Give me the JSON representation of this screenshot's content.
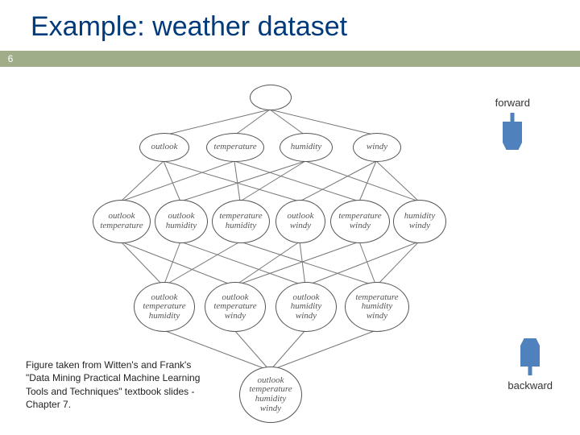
{
  "title": "Example: weather dataset",
  "page_number": "6",
  "labels": {
    "forward": "forward",
    "backward": "backward"
  },
  "caption": "Figure taken from Witten's and Frank's \"Data Mining Practical Machine Learning Tools and Techniques\" textbook slides - Chapter 7.",
  "arrow_color": "#4f81bd",
  "nodes": {
    "root": "",
    "l1a": "outlook",
    "l1b": "temperature",
    "l1c": "humidity",
    "l1d": "windy",
    "l2a": "outlook\ntemperature",
    "l2b": "outlook\nhumidity",
    "l2c": "temperature\nhumidity",
    "l2d": "outlook\nwindy",
    "l2e": "temperature\nwindy",
    "l2f": "humidity\nwindy",
    "l3a": "outlook\ntemperature\nhumidity",
    "l3b": "outlook\ntemperature\nwindy",
    "l3c": "outlook\nhumidity\nwindy",
    "l3d": "temperature\nhumidity\nwindy",
    "l4": "outlook\ntemperature\nhumidity\nwindy"
  }
}
